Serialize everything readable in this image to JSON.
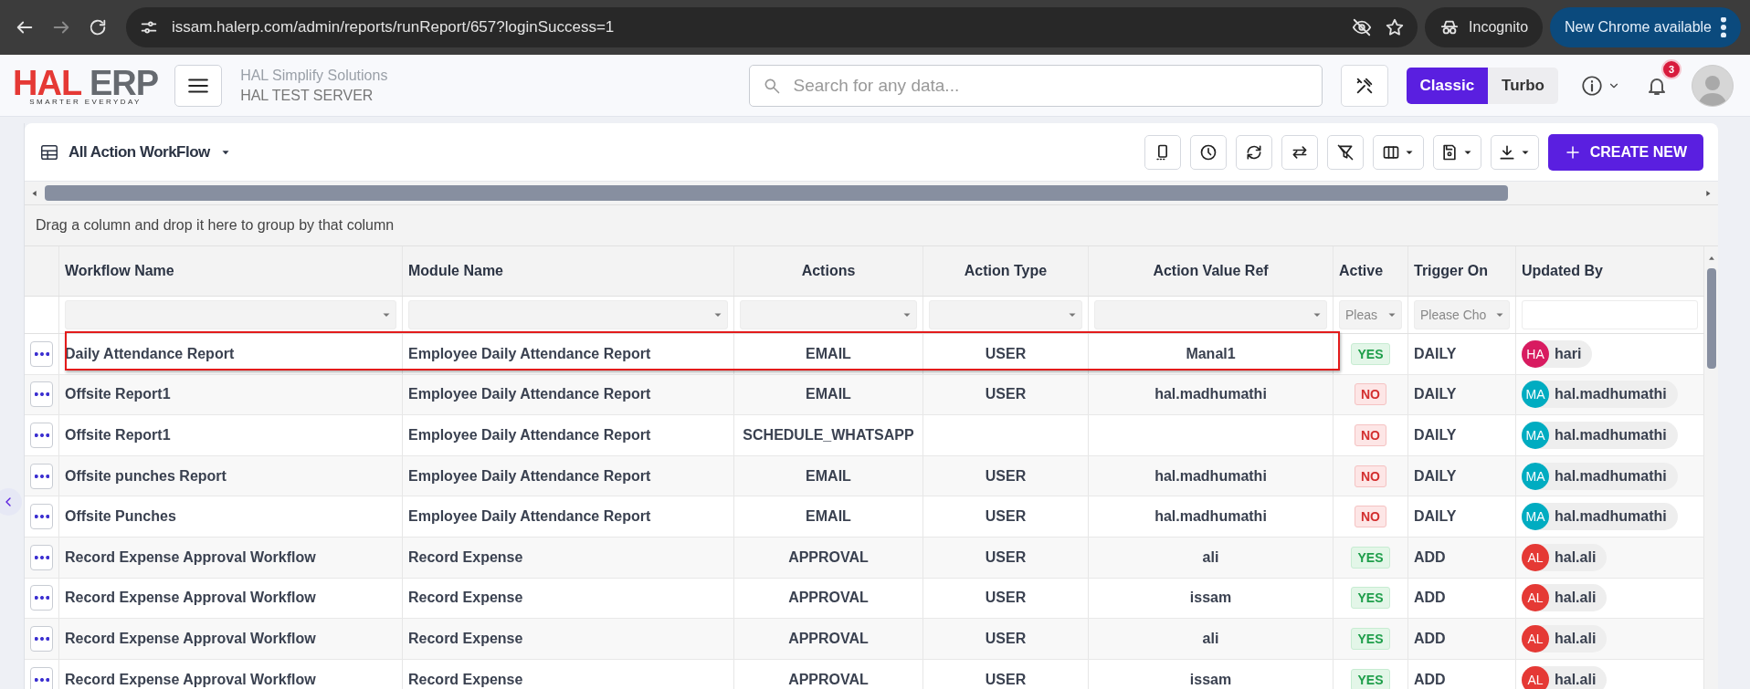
{
  "browser": {
    "url": "issam.halerp.com/admin/reports/runReport/657?loginSuccess=1",
    "forward_disabled": true,
    "profile": "Incognito",
    "update_label": "New Chrome available"
  },
  "header": {
    "logo": {
      "primary": "HAL",
      "secondary": "ERP",
      "tagline": "SMARTER EVERYDAY"
    },
    "company": "HAL Simplify Solutions",
    "server": "HAL TEST SERVER",
    "search": {
      "placeholder": "Search for any data..."
    },
    "modes": [
      {
        "label": "Classic",
        "selected": true
      },
      {
        "label": "Turbo",
        "selected": false
      }
    ],
    "notifications": "3"
  },
  "report": {
    "title": "All Action WorkFlow",
    "create_label": "CREATE NEW",
    "group_hint": "Drag a column and drop it here to group by that column",
    "columns": [
      "Workflow Name",
      "Module Name",
      "Actions",
      "Action Type",
      "Action Value Ref",
      "Active",
      "Trigger On",
      "Updated By"
    ],
    "filters": [
      {
        "kind": "select"
      },
      {
        "kind": "select"
      },
      {
        "kind": "select"
      },
      {
        "kind": "select"
      },
      {
        "kind": "select"
      },
      {
        "kind": "select",
        "placeholder": "Pleas"
      },
      {
        "kind": "select",
        "placeholder": "Please Cho"
      },
      {
        "kind": "text"
      }
    ],
    "rows": [
      {
        "workflow": "Daily Attendance Report",
        "module": "Employee Daily Attendance Report",
        "action": "EMAIL",
        "action_type": "USER",
        "value_ref": "Manal1",
        "active": {
          "label": "YES",
          "on": true
        },
        "trigger": "DAILY",
        "user": {
          "initials": "HA",
          "name": "hari",
          "color": "#d81b60"
        },
        "highlighted": true
      },
      {
        "workflow": "Offsite Report1",
        "module": "Employee Daily Attendance Report",
        "action": "EMAIL",
        "action_type": "USER",
        "value_ref": "hal.madhumathi",
        "active": {
          "label": "NO",
          "on": false
        },
        "trigger": "DAILY",
        "user": {
          "initials": "MA",
          "name": "hal.madhumathi",
          "color": "#00acc1"
        },
        "highlighted": false
      },
      {
        "workflow": "Offsite Report1",
        "module": "Employee Daily Attendance Report",
        "action": "SCHEDULE_WHATSAPP",
        "active": {
          "label": "NO",
          "on": false
        },
        "trigger": "DAILY",
        "user": {
          "initials": "MA",
          "name": "hal.madhumathi",
          "color": "#00acc1"
        },
        "highlighted": false
      },
      {
        "workflow": "Offsite punches Report",
        "module": "Employee Daily Attendance Report",
        "action": "EMAIL",
        "action_type": "USER",
        "value_ref": "hal.madhumathi",
        "active": {
          "label": "NO",
          "on": false
        },
        "trigger": "DAILY",
        "user": {
          "initials": "MA",
          "name": "hal.madhumathi",
          "color": "#00acc1"
        },
        "highlighted": false
      },
      {
        "workflow": "Offsite Punches",
        "module": "Employee Daily Attendance Report",
        "action": "EMAIL",
        "action_type": "USER",
        "value_ref": "hal.madhumathi",
        "active": {
          "label": "NO",
          "on": false
        },
        "trigger": "DAILY",
        "user": {
          "initials": "MA",
          "name": "hal.madhumathi",
          "color": "#00acc1"
        },
        "highlighted": false
      },
      {
        "workflow": "Record Expense Approval Workflow",
        "module": "Record Expense",
        "action": "APPROVAL",
        "action_type": "USER",
        "value_ref": "ali",
        "active": {
          "label": "YES",
          "on": true
        },
        "trigger": "ADD",
        "user": {
          "initials": "AL",
          "name": "hal.ali",
          "color": "#e53935"
        },
        "highlighted": false
      },
      {
        "workflow": "Record Expense Approval Workflow",
        "module": "Record Expense",
        "action": "APPROVAL",
        "action_type": "USER",
        "value_ref": "issam",
        "active": {
          "label": "YES",
          "on": true
        },
        "trigger": "ADD",
        "user": {
          "initials": "AL",
          "name": "hal.ali",
          "color": "#e53935"
        },
        "highlighted": false
      },
      {
        "workflow": "Record Expense Approval Workflow",
        "module": "Record Expense",
        "action": "APPROVAL",
        "action_type": "USER",
        "value_ref": "ali",
        "active": {
          "label": "YES",
          "on": true
        },
        "trigger": "ADD",
        "user": {
          "initials": "AL",
          "name": "hal.ali",
          "color": "#e53935"
        },
        "highlighted": false
      },
      {
        "workflow": "Record Expense Approval Workflow",
        "module": "Record Expense",
        "action": "APPROVAL",
        "action_type": "USER",
        "value_ref": "issam",
        "active": {
          "label": "YES",
          "on": true
        },
        "trigger": "ADD",
        "user": {
          "initials": "AL",
          "name": "hal.ali",
          "color": "#e53935"
        },
        "highlighted": false
      }
    ]
  }
}
